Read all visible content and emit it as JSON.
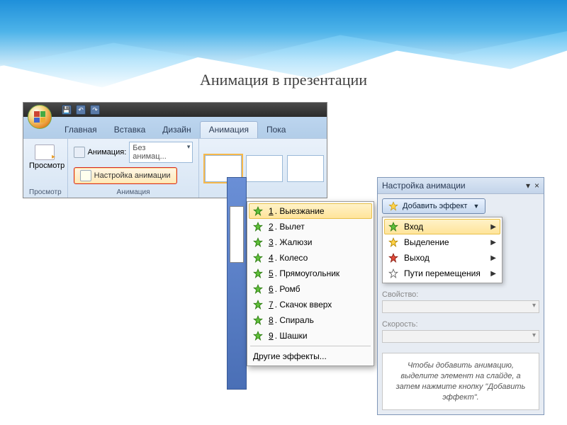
{
  "title": "Анимация в презентации",
  "ribbon": {
    "tabs": [
      "Главная",
      "Вставка",
      "Дизайн",
      "Анимация",
      "Пока"
    ],
    "active_index": 3,
    "group_preview_label": "Просмотр",
    "preview_btn": "Просмотр",
    "group_anim_label": "Анимация",
    "anim_label": "Анимация:",
    "anim_value": "Без анимац...",
    "custom_btn": "Настройка анимации"
  },
  "effects_menu": {
    "items": [
      {
        "n": "1",
        "label": "Выезжание"
      },
      {
        "n": "2",
        "label": "Вылет"
      },
      {
        "n": "3",
        "label": "Жалюзи"
      },
      {
        "n": "4",
        "label": "Колесо"
      },
      {
        "n": "5",
        "label": "Прямоугольник"
      },
      {
        "n": "6",
        "label": "Ромб"
      },
      {
        "n": "7",
        "label": "Скачок вверх"
      },
      {
        "n": "8",
        "label": "Спираль"
      },
      {
        "n": "9",
        "label": "Шашки"
      }
    ],
    "more": "Другие эффекты..."
  },
  "taskpane": {
    "title": "Настройка анимации",
    "add_effect": "Добавить эффект",
    "menu": [
      {
        "label": "Вход",
        "star": "green"
      },
      {
        "label": "Выделение",
        "star": "gold"
      },
      {
        "label": "Выход",
        "star": "red"
      },
      {
        "label": "Пути перемещения",
        "star": "outline"
      }
    ],
    "prop_label": "Свойство:",
    "speed_label": "Скорость:",
    "hint": "Чтобы добавить анимацию, выделите элемент на слайде, а затем нажмите кнопку \"Добавить эффект\"."
  }
}
